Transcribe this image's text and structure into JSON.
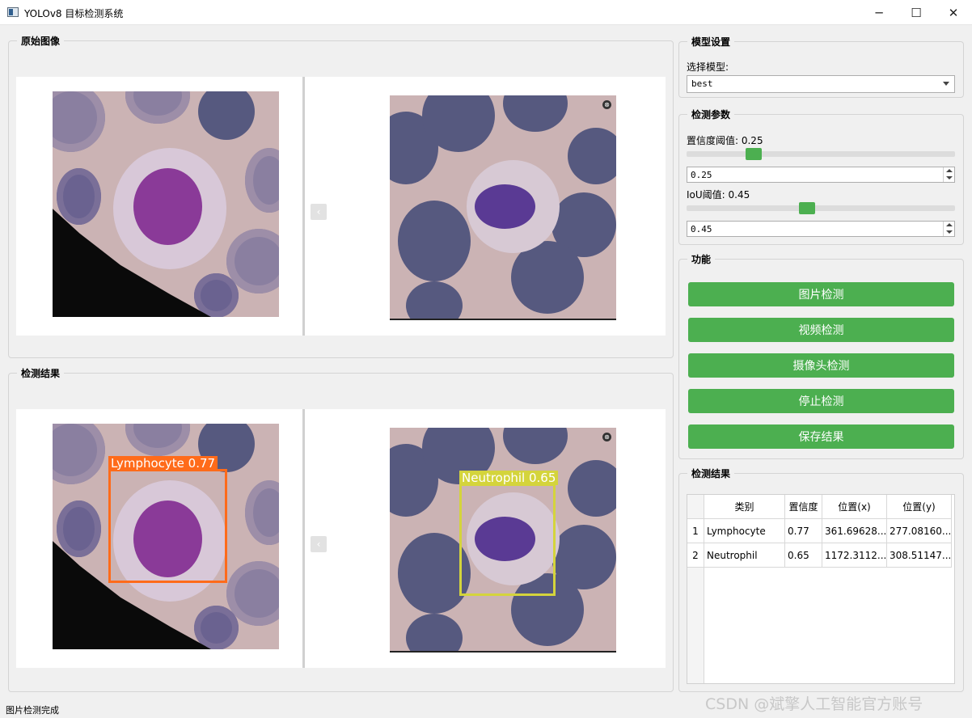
{
  "window": {
    "title": "YOLOv8 目标检测系统",
    "minimize_glyph": "─",
    "maximize_glyph": "☐",
    "close_glyph": "✕"
  },
  "original_group": {
    "title": "原始图像",
    "prev_glyph": "‹"
  },
  "result_group": {
    "title": "检测结果",
    "prev_glyph": "‹"
  },
  "detections_on_image": [
    {
      "label": "Lymphocyte 0.77",
      "color": "#ff6b1a"
    },
    {
      "label": "Neutrophil 0.65",
      "color": "#d4d43c"
    }
  ],
  "model_settings": {
    "title": "模型设置",
    "select_label": "选择模型:",
    "selected_model": "best"
  },
  "detect_params": {
    "title": "检测参数",
    "conf_label": "置信度阈值: 0.25",
    "conf_value": "0.25",
    "conf_fraction": 0.25,
    "iou_label": "IoU阈值: 0.45",
    "iou_value": "0.45",
    "iou_fraction": 0.45,
    "accent": "#4caf50"
  },
  "functions": {
    "title": "功能",
    "buttons": [
      "图片检测",
      "视频检测",
      "摄像头检测",
      "停止检测",
      "保存结果"
    ]
  },
  "results_table": {
    "title": "检测结果",
    "headers": [
      "类别",
      "置信度",
      "位置(x)",
      "位置(y)"
    ],
    "rows": [
      {
        "index": "1",
        "cells": [
          "Lymphocyte",
          "0.77",
          "361.69628...",
          "277.08160..."
        ]
      },
      {
        "index": "2",
        "cells": [
          "Neutrophil",
          "0.65",
          "1172.3112...",
          "308.51147..."
        ]
      }
    ]
  },
  "status": {
    "text": "图片检测完成"
  },
  "watermark": "CSDN @斌擎人工智能官方账号"
}
